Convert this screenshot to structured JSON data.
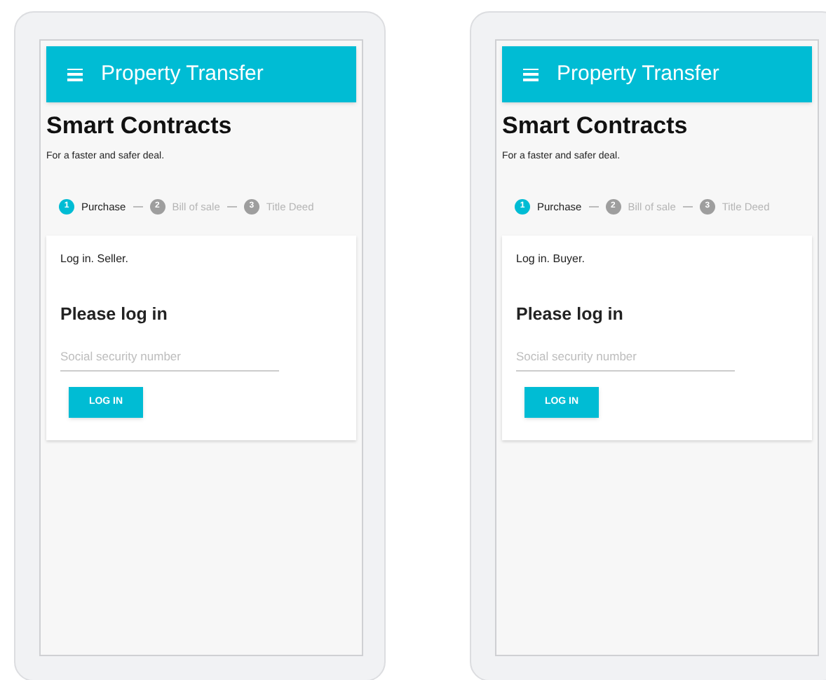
{
  "phones": [
    {
      "app_bar": {
        "title": "Property Transfer"
      },
      "heading": "Smart Contracts",
      "subtitle": "For a faster and safer deal.",
      "steps": [
        {
          "number": "1",
          "label": "Purchase",
          "selected": true
        },
        {
          "number": "2",
          "label": "Bill of sale",
          "selected": false
        },
        {
          "number": "3",
          "label": "Title Deed",
          "selected": false
        }
      ],
      "card": {
        "role_text": "Log in. Seller.",
        "login_heading": "Please log in",
        "field": {
          "placeholder": "Social security number"
        },
        "button": "LOG IN"
      }
    },
    {
      "app_bar": {
        "title": "Property Transfer"
      },
      "heading": "Smart Contracts",
      "subtitle": "For a faster and safer deal.",
      "steps": [
        {
          "number": "1",
          "label": "Purchase",
          "selected": true
        },
        {
          "number": "2",
          "label": "Bill of sale",
          "selected": false
        },
        {
          "number": "3",
          "label": "Title Deed",
          "selected": false
        }
      ],
      "card": {
        "role_text": "Log in. Buyer.",
        "login_heading": "Please log in",
        "field": {
          "placeholder": "Social security number"
        },
        "button": "LOG IN"
      }
    }
  ]
}
